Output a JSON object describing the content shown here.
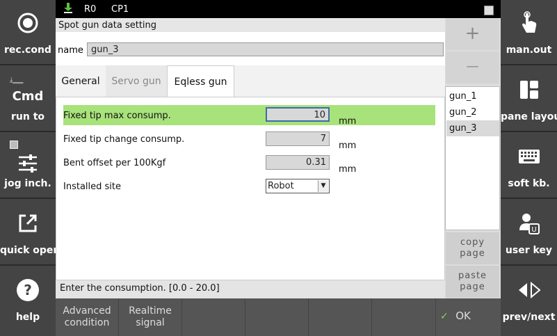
{
  "status": {
    "robot": "R0",
    "program": "CP1"
  },
  "left_menu": [
    {
      "icon": "record-icon",
      "label": "rec.cond"
    },
    {
      "icon": "cmd-icon",
      "label": "run to",
      "cmd_text": "Cmd"
    },
    {
      "icon": "sliders-icon",
      "label": "jog inch."
    },
    {
      "icon": "external-link-icon",
      "label": "quick open"
    },
    {
      "icon": "help-icon",
      "label": "help"
    }
  ],
  "right_menu": [
    {
      "icon": "hand-pointer-icon",
      "label": "man.out"
    },
    {
      "icon": "pane-layout-icon",
      "label": "pane layout"
    },
    {
      "icon": "keyboard-icon",
      "label": "soft kb."
    },
    {
      "icon": "user-key-icon",
      "label": "user key"
    },
    {
      "icon": "prev-next-icon",
      "label": "prev/next"
    }
  ],
  "window_title": "Spot gun data setting",
  "name_label": "name",
  "name_value": "gun_3",
  "tabs": [
    "General",
    "Servo gun",
    "Eqless gun"
  ],
  "active_tab": 2,
  "rows": [
    {
      "label": "Fixed tip max consump.",
      "value": "10",
      "unit": "mm"
    },
    {
      "label": "Fixed tip change consump.",
      "value": "7",
      "unit": "mm"
    },
    {
      "label": "Bent offset per 100Kgf",
      "value": "0.31",
      "unit": "mm"
    },
    {
      "label": "Installed site",
      "value": "Robot"
    }
  ],
  "status_message": "Enter the consumption. [0.0 - 20.0]",
  "gun_list": [
    "gun_1",
    "gun_2",
    "gun_3"
  ],
  "selected_gun": "gun_3",
  "list_buttons": {
    "add": "+",
    "remove": "—"
  },
  "page_buttons": {
    "copy": [
      "copy",
      "page"
    ],
    "paste": [
      "paste",
      "page"
    ]
  },
  "bottom_buttons": [
    {
      "line1": "Advanced",
      "line2": "condition"
    },
    {
      "line1": "Realtime",
      "line2": "signal"
    }
  ],
  "ok_label": "OK",
  "colors": {
    "highlight": "#a8e27a",
    "sidebar": "#444444",
    "topbar": "#000000"
  }
}
